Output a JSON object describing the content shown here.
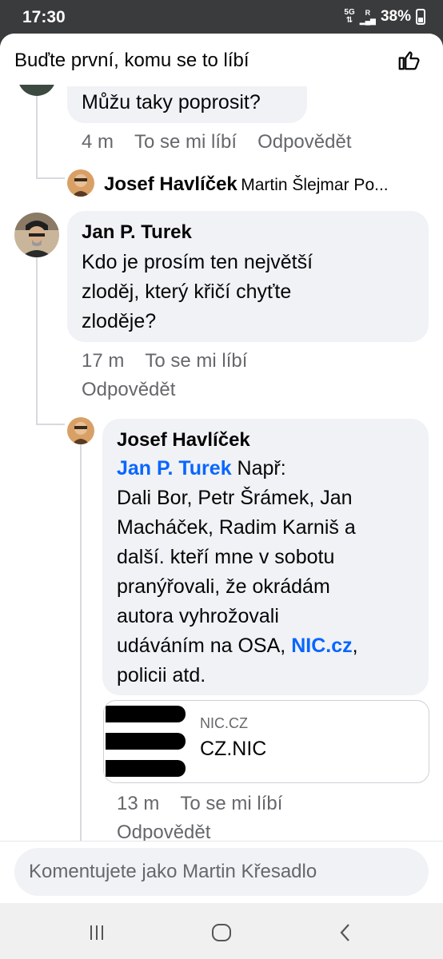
{
  "status": {
    "time": "17:30",
    "network": "5G",
    "signal_label": "R",
    "battery": "38%"
  },
  "header": {
    "title": "Buďte první, komu se to líbí"
  },
  "comments": {
    "c0": {
      "text": "Můžu taky poprosit?",
      "time": "4 m",
      "like": "To se mi líbí",
      "reply": "Odpovědět"
    },
    "collapsed_reply": {
      "name": "Josef Havlíček",
      "preview": "Martin Šlejmar Po..."
    },
    "c1": {
      "name": "Jan P. Turek",
      "lines": [
        "Kdo je prosím ten největší",
        "zloděj, který křičí chyťte",
        "zloděje?"
      ],
      "time": "17 m",
      "like": "To se mi líbí",
      "reply": "Odpovědět"
    },
    "c2": {
      "name": "Josef Havlíček",
      "mention": "Jan P. Turek",
      "first": "Např:",
      "lines": [
        "Dali Bor, Petr Šrámek, Jan",
        "Macháček, Radim Karniš a",
        "další. kteří mne v sobotu",
        "pranýřovali, že okrádám",
        "autora  vyhrožovali"
      ],
      "pre_link": "udáváním na OSA, ",
      "link": "NIC.cz",
      "post_link": ",",
      "last": "policii atd.",
      "time": "13 m",
      "like": "To se mi líbí",
      "reply": "Odpovědět"
    }
  },
  "link_card": {
    "domain": "NIC.CZ",
    "title": "CZ.NIC"
  },
  "composer": {
    "placeholder": "Komentujete jako Martin Křesadlo"
  },
  "colors": {
    "link": "#0866ff",
    "bubble": "#f0f2f5",
    "meta": "#65676b"
  }
}
